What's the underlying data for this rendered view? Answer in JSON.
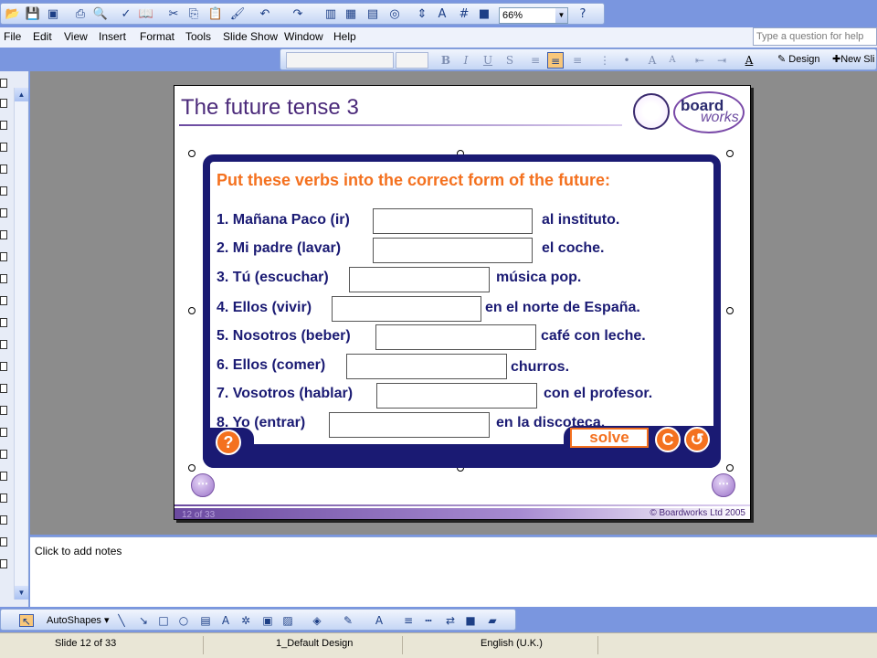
{
  "toolbar": {
    "zoom": "66%"
  },
  "menu": {
    "items": [
      "File",
      "Edit",
      "View",
      "Insert",
      "Format",
      "Tools",
      "Slide Show",
      "Window",
      "Help"
    ],
    "help_placeholder": "Type a question for help"
  },
  "format_toolbar": {
    "bold": "B",
    "italic": "I",
    "underline": "U",
    "shadow": "S",
    "design_label": "Design",
    "new_slide_label": "New Sli"
  },
  "slide": {
    "title": "The future tense 3",
    "logo_text1": "board",
    "logo_text2": "works",
    "instruction": "Put these verbs into the correct form of the future:",
    "questions": [
      {
        "prompt": "1. Mañana Paco (ir)",
        "suffix": "al instituto."
      },
      {
        "prompt": "2. Mi padre (lavar)",
        "suffix": "el coche."
      },
      {
        "prompt": "3. Tú (escuchar)",
        "suffix": "música pop."
      },
      {
        "prompt": "4. Ellos (vivir)",
        "suffix": "en el norte de España."
      },
      {
        "prompt": "5. Nosotros (beber)",
        "suffix": "café con leche."
      },
      {
        "prompt": "6. Ellos (comer)",
        "suffix": "churros."
      },
      {
        "prompt": "7. Vosotros (hablar)",
        "suffix": "con el profesor."
      },
      {
        "prompt": "8. Yo (entrar)",
        "suffix": "en la discoteca."
      }
    ],
    "help_button": "?",
    "solve_button": "solve",
    "clear_button": "C",
    "undo_button": "↺",
    "slide_counter": "12 of 33",
    "copyright": "© Boardworks Ltd 2005"
  },
  "notes": {
    "placeholder": "Click to add notes"
  },
  "draw_toolbar": {
    "autoshapes": "AutoShapes"
  },
  "status": {
    "slide": "Slide 12 of 33",
    "design": "1_Default Design",
    "language": "English (U.K.)"
  }
}
